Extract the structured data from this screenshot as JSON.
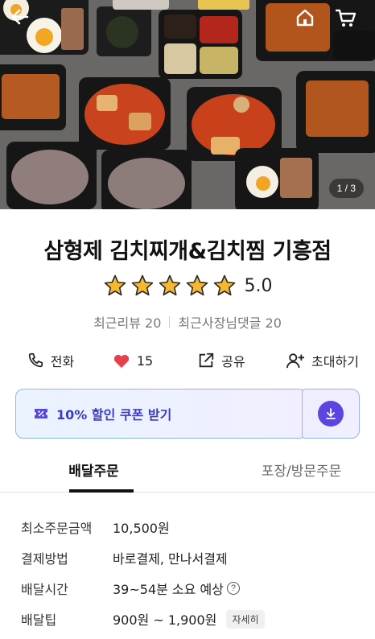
{
  "hero": {
    "back_icon": "back-arrow-icon",
    "home_icon": "home-icon",
    "cart_icon": "cart-icon",
    "counter": "1 / 3"
  },
  "store": {
    "name": "삼형제 김치찌개&김치찜 기흥점",
    "rating_value": "5.0",
    "rating_stars": 5,
    "star_color": "#f5b82e",
    "recent_reviews": "최근리뷰 20",
    "recent_owner_replies": "최근사장님댓글 20"
  },
  "actions": {
    "call": {
      "icon": "phone-icon",
      "label": "전화"
    },
    "like": {
      "icon": "heart-icon",
      "label": "15",
      "color": "#e8404b"
    },
    "share": {
      "icon": "share-icon",
      "label": "공유"
    },
    "invite": {
      "icon": "invite-user-icon",
      "label": "초대하기"
    }
  },
  "coupon": {
    "icon": "coupon-icon",
    "label": "10% 할인 쿠폰 받기",
    "download_icon": "download-icon",
    "accent": "#5a45e0"
  },
  "tabs": [
    {
      "label": "배달주문",
      "active": true
    },
    {
      "label": "포장/방문주문",
      "active": false
    }
  ],
  "info": {
    "min_order": {
      "key": "최소주문금액",
      "value": "10,500원"
    },
    "payment": {
      "key": "결제방법",
      "value": "바로결제, 만나서결제"
    },
    "delivery_time": {
      "key": "배달시간",
      "value": "39~54분 소요 예상",
      "help": "?"
    },
    "delivery_tip": {
      "key": "배달팁",
      "value": "900원 ~ 1,900원",
      "detail": "자세히"
    }
  }
}
